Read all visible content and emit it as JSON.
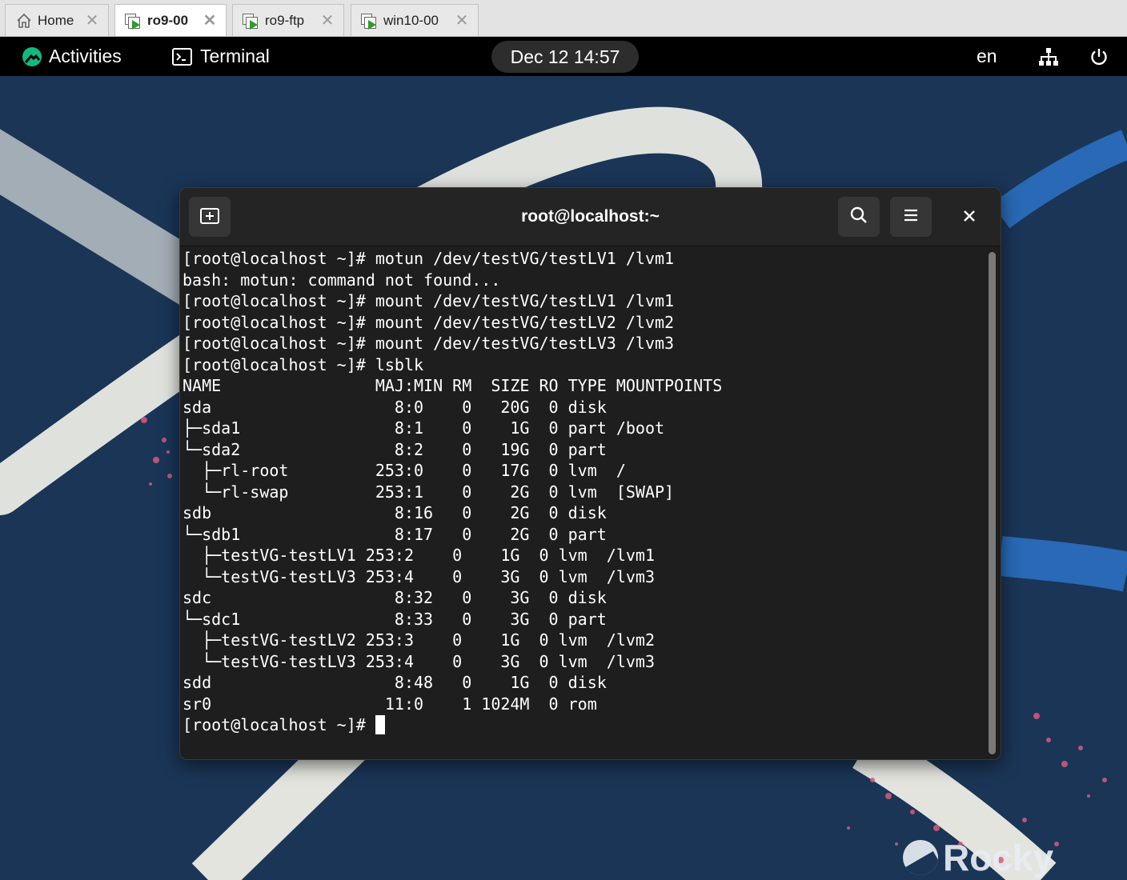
{
  "vm_tabs": [
    {
      "label": "Home",
      "icon": "home-icon",
      "active": false
    },
    {
      "label": "ro9-00",
      "icon": "vm-running-icon",
      "active": true
    },
    {
      "label": "ro9-ftp",
      "icon": "vm-running-icon",
      "active": false
    },
    {
      "label": "win10-00",
      "icon": "vm-running-icon",
      "active": false
    }
  ],
  "topbar": {
    "activities": "Activities",
    "app": "Terminal",
    "clock": "Dec 12  14:57",
    "lang": "en"
  },
  "terminal": {
    "title": "root@localhost:~",
    "lines": [
      "[root@localhost ~]# motun /dev/testVG/testLV1 /lvm1",
      "bash: motun: command not found...",
      "[root@localhost ~]# mount /dev/testVG/testLV1 /lvm1",
      "[root@localhost ~]# mount /dev/testVG/testLV2 /lvm2",
      "[root@localhost ~]# mount /dev/testVG/testLV3 /lvm3",
      "[root@localhost ~]# lsblk",
      "NAME                MAJ:MIN RM  SIZE RO TYPE MOUNTPOINTS",
      "sda                   8:0    0   20G  0 disk",
      "├─sda1                8:1    0    1G  0 part /boot",
      "└─sda2                8:2    0   19G  0 part",
      "  ├─rl-root         253:0    0   17G  0 lvm  /",
      "  └─rl-swap         253:1    0    2G  0 lvm  [SWAP]",
      "sdb                   8:16   0    2G  0 disk",
      "└─sdb1                8:17   0    2G  0 part",
      "  ├─testVG-testLV1 253:2    0    1G  0 lvm  /lvm1",
      "  └─testVG-testLV3 253:4    0    3G  0 lvm  /lvm3",
      "sdc                   8:32   0    3G  0 disk",
      "└─sdc1                8:33   0    3G  0 part",
      "  ├─testVG-testLV2 253:3    0    1G  0 lvm  /lvm2",
      "  └─testVG-testLV3 253:4    0    3G  0 lvm  /lvm3",
      "sdd                   8:48   0    1G  0 disk",
      "sr0                  11:0    1 1024M  0 rom"
    ],
    "prompt": "[root@localhost ~]#"
  },
  "desktop": {
    "logo_text": "Rocky"
  },
  "colors": {
    "desktop_bg": "#1a3556",
    "terminal_bg": "#1e1e1e",
    "header_bg": "#242424",
    "accent_green": "#10b981"
  }
}
